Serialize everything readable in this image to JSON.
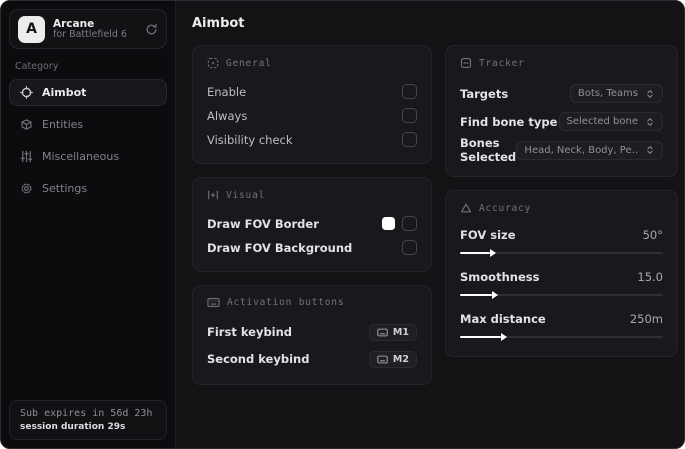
{
  "app": {
    "name": "Arcane",
    "subtitle": "for Battlefield 6",
    "avatar_letter": "A"
  },
  "sidebar": {
    "category_label": "Category",
    "items": [
      {
        "label": "Aimbot",
        "icon": "crosshair-icon",
        "active": true
      },
      {
        "label": "Entities",
        "icon": "cube-icon",
        "active": false
      },
      {
        "label": "Miscellaneous",
        "icon": "sliders-icon",
        "active": false
      },
      {
        "label": "Settings",
        "icon": "gear-icon",
        "active": false
      }
    ],
    "subscription": {
      "line1": "Sub expires in 56d 23h",
      "line2": "session duration 29s"
    }
  },
  "page": {
    "title": "Aimbot"
  },
  "cards": {
    "general": {
      "title": "General",
      "rows": [
        {
          "label": "Enable",
          "checked": false
        },
        {
          "label": "Always",
          "checked": false
        },
        {
          "label": "Visibility check",
          "checked": false
        }
      ]
    },
    "visual": {
      "title": "Visual",
      "rows": [
        {
          "label": "Draw FOV Border",
          "swatch_color": "#ffffff",
          "checked": false
        },
        {
          "label": "Draw FOV Background",
          "checked": false
        }
      ]
    },
    "activation": {
      "title": "Activation buttons",
      "rows": [
        {
          "label": "First keybind",
          "key": "M1"
        },
        {
          "label": "Second keybind",
          "key": "M2"
        }
      ]
    },
    "tracker": {
      "title": "Tracker",
      "rows": [
        {
          "label": "Targets",
          "value": "Bots, Teams"
        },
        {
          "label": "Find bone type",
          "value": "Selected bone"
        },
        {
          "label": "Bones Selected",
          "value": "Head, Neck, Body, Pe.."
        }
      ]
    },
    "accuracy": {
      "title": "Accuracy",
      "rows": [
        {
          "label": "FOV size",
          "value": "50°",
          "percent": 15
        },
        {
          "label": "Smoothness",
          "value": "15.0",
          "percent": 16
        },
        {
          "label": "Max distance",
          "value": "250m",
          "percent": 20
        }
      ]
    }
  }
}
